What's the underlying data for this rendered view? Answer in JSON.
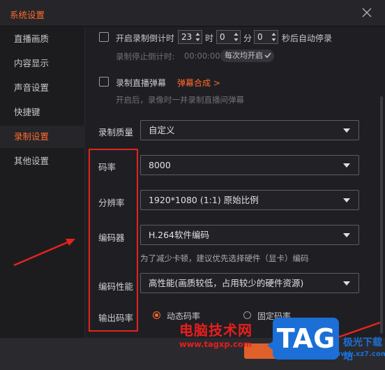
{
  "window": {
    "title": "系统设置"
  },
  "sidebar": {
    "items": [
      {
        "label": "直播画质"
      },
      {
        "label": "内容显示"
      },
      {
        "label": "声音设置"
      },
      {
        "label": "快捷键"
      },
      {
        "label": "录制设置"
      },
      {
        "label": "其他设置"
      }
    ],
    "active_index": 4
  },
  "countdown": {
    "checkbox_label": "开启录制倒计时",
    "hour_value": "23",
    "hour_unit": "时",
    "minute_value": "0",
    "minute_unit": "分",
    "second_value": "0",
    "second_unit": "秒后自动停录",
    "remaining_label": "录制停止倒计时:",
    "remaining_value": "00:00:00",
    "each_time_label": "每次均开启"
  },
  "barrage": {
    "checkbox_label": "录制直播弹幕",
    "compose_link": "弹幕合成 >",
    "hint": "开启后，录像时一并录制直播间弹幕"
  },
  "fields": {
    "quality": {
      "label": "录制质量",
      "value": "自定义"
    },
    "bitrate": {
      "label": "码率",
      "value": "8000"
    },
    "resolution": {
      "label": "分辨率",
      "value": "1920*1080 (1:1) 原始比例"
    },
    "encoder": {
      "label": "编码器",
      "value": "H.264软件编码",
      "hint": "为了减少卡顿，建议优先选择硬件（显卡）编码"
    },
    "performance": {
      "label": "编码性能",
      "value": "高性能(画质较低，占用较少的硬件资源)"
    },
    "output_bitrate": {
      "label": "输出码率",
      "options": [
        "动态码率",
        "固定码率"
      ],
      "selected": "动态码率"
    }
  },
  "watermark": {
    "text": "电脑技术网",
    "url": "www.tagxp.com",
    "tag": "TAG",
    "download": "极光下载站",
    "download_url": "www.xz7.com"
  },
  "colors": {
    "accent": "#ff6a2a",
    "annotation_red": "#e4241c",
    "background": "#1f1f23"
  }
}
